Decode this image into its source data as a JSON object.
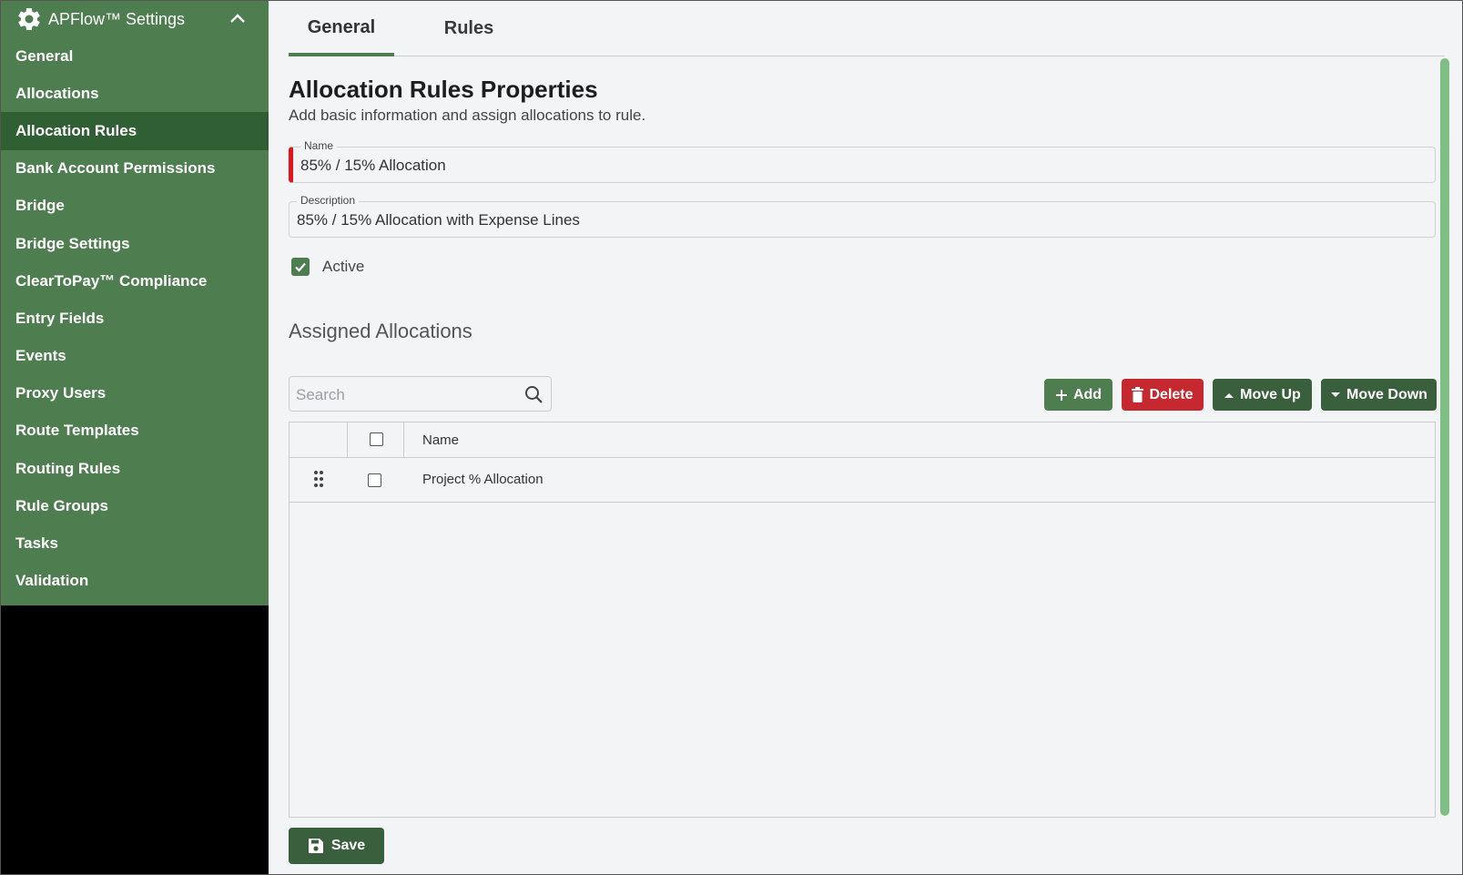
{
  "colors": {
    "sidebar_bg": "#4e7d4f",
    "sidebar_active": "#2f5f33",
    "add_button": "#4e7d4f",
    "delete_button": "#c5292f",
    "move_buttons": "#3a5f3c",
    "required_marker": "#e0161b",
    "scrollbar": "#7fbf86"
  },
  "sidebar": {
    "title": "APFlow™ Settings",
    "header_icon": "gear-icon",
    "collapse_icon": "chevron-up-icon",
    "items": [
      {
        "label": "General",
        "active": false
      },
      {
        "label": "Allocations",
        "active": false
      },
      {
        "label": "Allocation Rules",
        "active": true
      },
      {
        "label": "Bank Account Permissions",
        "active": false
      },
      {
        "label": "Bridge",
        "active": false
      },
      {
        "label": "Bridge Settings",
        "active": false
      },
      {
        "label": "ClearToPay™ Compliance",
        "active": false
      },
      {
        "label": "Entry Fields",
        "active": false
      },
      {
        "label": "Events",
        "active": false
      },
      {
        "label": "Proxy Users",
        "active": false
      },
      {
        "label": "Route Templates",
        "active": false
      },
      {
        "label": "Routing Rules",
        "active": false
      },
      {
        "label": "Rule Groups",
        "active": false
      },
      {
        "label": "Tasks",
        "active": false
      },
      {
        "label": "Validation",
        "active": false
      }
    ]
  },
  "tabs": [
    {
      "label": "General",
      "active": true
    },
    {
      "label": "Rules",
      "active": false
    }
  ],
  "form": {
    "title": "Allocation Rules Properties",
    "subtitle": "Add basic information and assign allocations to rule.",
    "name_label": "Name",
    "name_value": "85% / 15% Allocation",
    "description_label": "Description",
    "description_value": "85% / 15% Allocation with Expense Lines",
    "active_label": "Active",
    "active_checked": true
  },
  "assigned": {
    "title": "Assigned Allocations",
    "search_placeholder": "Search",
    "buttons": {
      "add": "Add",
      "delete": "Delete",
      "move_up": "Move Up",
      "move_down": "Move Down"
    },
    "columns": [
      "",
      "",
      "Name"
    ],
    "rows": [
      {
        "name": "Project % Allocation",
        "checked": false
      }
    ]
  },
  "save_label": "Save"
}
